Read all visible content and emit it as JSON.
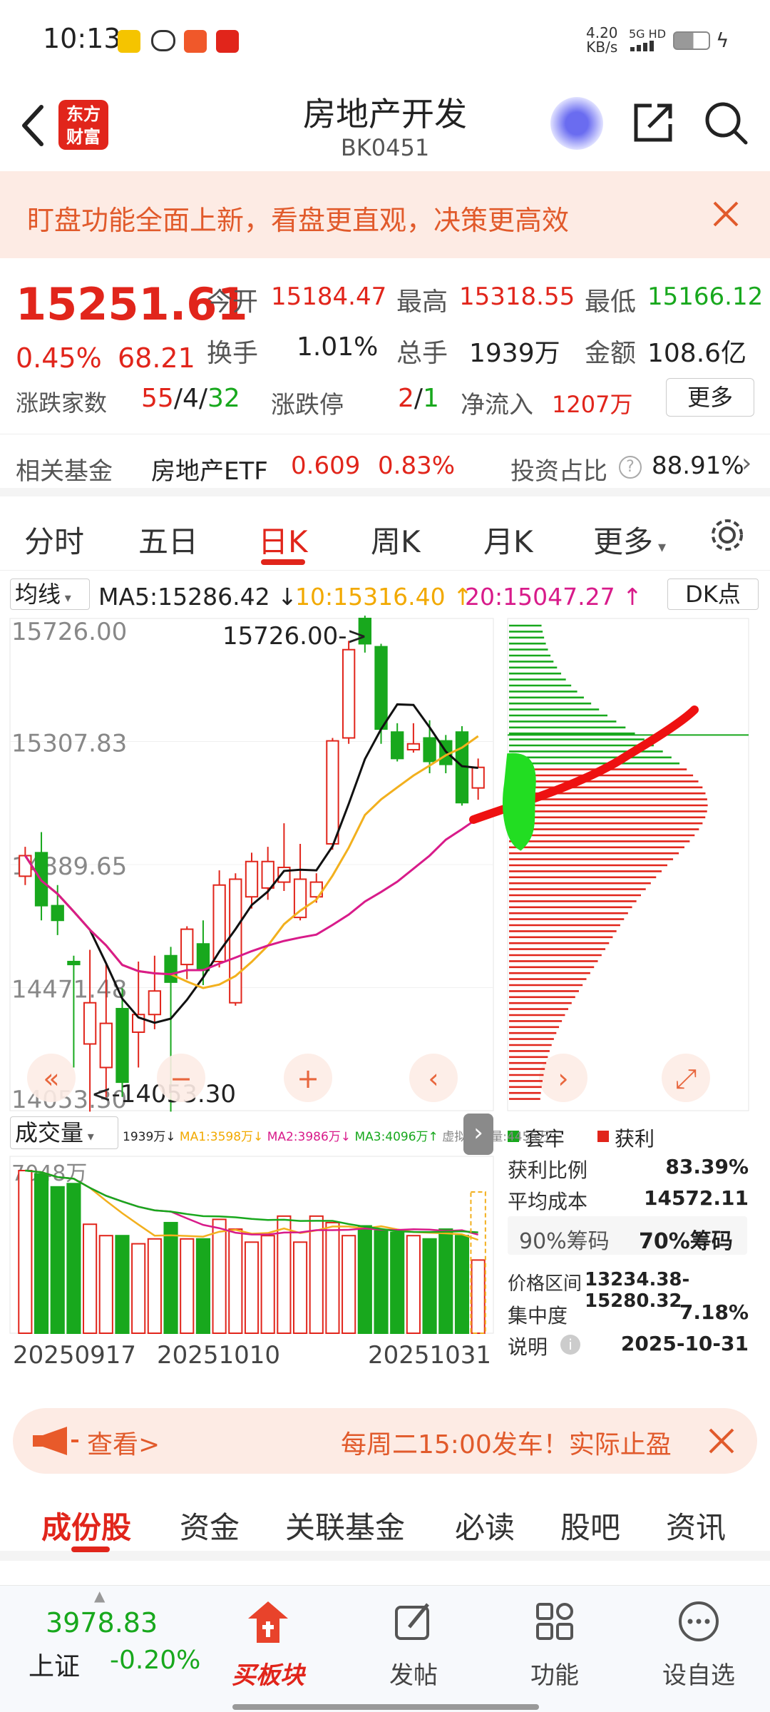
{
  "status": {
    "time": "10:13",
    "net_speed": "4.20",
    "net_unit": "KB/s",
    "net_type": "5G HD"
  },
  "header": {
    "logo_line1": "东方",
    "logo_line2": "财富",
    "title": "房地产开发",
    "code": "BK0451"
  },
  "banner": {
    "text": "盯盘功能全面上新，看盘更直观，决策更高效"
  },
  "quote": {
    "price": "15251.61",
    "change_pct": "0.45%",
    "change": "68.21",
    "open_label": "今开",
    "open": "15184.47",
    "high_label": "最高",
    "high": "15318.55",
    "low_label": "最低",
    "low": "15166.12",
    "turnover_label": "换手",
    "turnover": "1.01%",
    "volume_label": "总手",
    "volume": "1939万",
    "amount_label": "金额",
    "amount": "108.6亿",
    "updown_label": "涨跌家数",
    "up_count": "55",
    "sep": "/",
    "flat_count": "4",
    "down_count": "32",
    "limit_label": "涨跌停",
    "limit_up": "2",
    "limit_down": "1",
    "inflow_label": "净流入",
    "inflow": "1207万",
    "more_button": "更多"
  },
  "fund": {
    "label": "相关基金",
    "name": "房地产ETF",
    "price": "0.609",
    "pct": "0.83%",
    "ratio_label": "投资占比",
    "ratio": "88.91%"
  },
  "tabs": [
    "分时",
    "五日",
    "日K",
    "周K",
    "月K",
    "更多"
  ],
  "active_tab": 2,
  "ma_bar": {
    "selector": "均线",
    "ma5": "MA5:15286.42",
    "ma10": "10:15316.40",
    "ma20": "20:15047.27",
    "dk_button": "DK点"
  },
  "chart_data": {
    "type": "candlestick",
    "y_labels": [
      "15726.00",
      "15307.83",
      "14889.65",
      "14471.48",
      "14053.30"
    ],
    "high_mark": "15726.00->",
    "low_mark": "<-14053.30",
    "ylim": [
      14053.3,
      15726.0
    ],
    "x_labels": [
      "20250917",
      "20251010",
      "20251031"
    ],
    "colors": {
      "up": "#e1251b",
      "down": "#18a81d",
      "ma5": "#111111",
      "ma10": "#f2b01e",
      "ma20": "#d81b8a"
    },
    "candles": [
      [
        14850,
        14950,
        14820,
        14920
      ],
      [
        14930,
        15000,
        14700,
        14750
      ],
      [
        14750,
        14820,
        14650,
        14700
      ],
      [
        14560,
        14580,
        14200,
        14550
      ],
      [
        14280,
        14600,
        14050,
        14420
      ],
      [
        14200,
        14550,
        14100,
        14350
      ],
      [
        14400,
        14470,
        14100,
        14150
      ],
      [
        14320,
        14560,
        14200,
        14380
      ],
      [
        14380,
        14580,
        14330,
        14460
      ],
      [
        14580,
        14610,
        14050,
        14490
      ],
      [
        14550,
        14680,
        14500,
        14670
      ],
      [
        14620,
        14700,
        14480,
        14530
      ],
      [
        14560,
        14870,
        14540,
        14820
      ],
      [
        14420,
        14860,
        14410,
        14840
      ],
      [
        14780,
        14930,
        14740,
        14900
      ],
      [
        14810,
        14950,
        14770,
        14900
      ],
      [
        14830,
        15030,
        14800,
        14880
      ],
      [
        14710,
        14960,
        14700,
        14840
      ],
      [
        14780,
        14860,
        14760,
        14830
      ],
      [
        14960,
        15320,
        14940,
        15310
      ],
      [
        15320,
        15650,
        15300,
        15620
      ],
      [
        15726,
        15740,
        15610,
        15640
      ],
      [
        15630,
        15640,
        15300,
        15350
      ],
      [
        15340,
        15370,
        15240,
        15250
      ],
      [
        15280,
        15370,
        15270,
        15300
      ],
      [
        15320,
        15380,
        15200,
        15240
      ],
      [
        15310,
        15330,
        15200,
        15230
      ],
      [
        15340,
        15360,
        15090,
        15100
      ],
      [
        15150,
        15250,
        15110,
        15220
      ]
    ],
    "volume_label": "成交量",
    "volume_info": [
      "1939万↓",
      "MA1:3598万↓",
      "MA2:3986万↓",
      "MA3:4096万↑",
      "虚拟成交量:4455万"
    ],
    "volume_top_label": "7048万",
    "volumes": [
      100,
      98,
      90,
      92,
      67,
      60,
      60,
      55,
      58,
      68,
      58,
      58,
      70,
      64,
      56,
      60,
      72,
      56,
      72,
      68,
      60,
      66,
      63,
      62,
      60,
      58,
      64,
      60,
      45
    ],
    "chip_legend": {
      "trapped": "套牢",
      "profit": "获利"
    },
    "chip": {
      "profit_ratio_label": "获利比例",
      "profit_ratio": "83.39%",
      "avg_cost_label": "平均成本",
      "avg_cost": "14572.11",
      "tab90": "90%筹码",
      "tab70": "70%筹码",
      "range_label": "价格区间",
      "range": "13234.38-15280.32",
      "concentration_label": "集中度",
      "concentration": "7.18%",
      "note_label": "说明",
      "date": "2025-10-31"
    }
  },
  "ad": {
    "left_text": "查看>",
    "right_text": "每周二15:00发车！实际止盈"
  },
  "subtabs": [
    "成份股",
    "资金",
    "关联基金",
    "必读",
    "股吧",
    "资讯"
  ],
  "bottom": {
    "index_value": "3978.83",
    "index_name": "上证",
    "index_pct": "-0.20%",
    "buy_label": "买板块",
    "post": "发帖",
    "function": "功能",
    "watch": "设自选"
  }
}
